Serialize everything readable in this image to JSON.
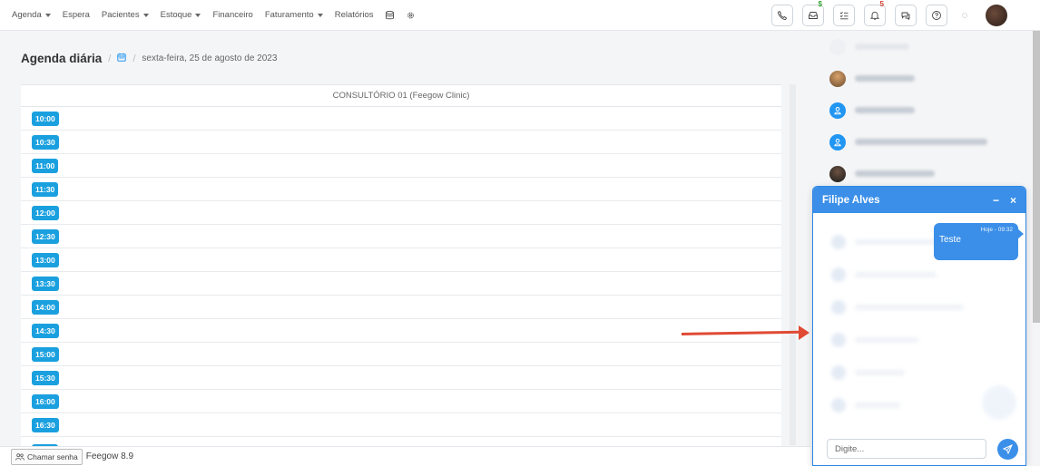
{
  "nav": {
    "items": [
      {
        "label": "Agenda",
        "dropdown": true
      },
      {
        "label": "Espera",
        "dropdown": false
      },
      {
        "label": "Pacientes",
        "dropdown": true
      },
      {
        "label": "Estoque",
        "dropdown": true
      },
      {
        "label": "Financeiro",
        "dropdown": false
      },
      {
        "label": "Faturamento",
        "dropdown": true
      },
      {
        "label": "Relatórios",
        "dropdown": false
      }
    ],
    "icons": [
      "database-icon",
      "gear-icon"
    ]
  },
  "toolbar": {
    "buttons": [
      {
        "icon": "phone-icon"
      },
      {
        "icon": "inbox-icon",
        "badge": "$"
      },
      {
        "icon": "checklist-icon"
      },
      {
        "icon": "bell-icon",
        "badge": "5"
      },
      {
        "icon": "chat-icon"
      },
      {
        "icon": "help-icon"
      }
    ]
  },
  "page": {
    "title": "Agenda diária",
    "date": "sexta-feira, 25 de agosto de 2023"
  },
  "agenda": {
    "room": "CONSULTÓRIO 01 (Feegow Clinic)",
    "slots": [
      "10:00",
      "10:30",
      "11:00",
      "11:30",
      "12:00",
      "12:30",
      "13:00",
      "13:30",
      "14:00",
      "14:30",
      "15:00",
      "15:30",
      "16:00",
      "16:30"
    ]
  },
  "footer": {
    "call_button": "Chamar senha",
    "version": "Feegow 8.9"
  },
  "chat": {
    "title": "Filipe Alves",
    "minimize": "−",
    "close": "×",
    "message": {
      "time": "Hoje - 09:32",
      "text": "Teste"
    },
    "input_placeholder": "Digite..."
  },
  "colors": {
    "accent": "#3b8fe8",
    "time_badge": "#1aa0df",
    "annotation_arrow": "#e04a34"
  }
}
